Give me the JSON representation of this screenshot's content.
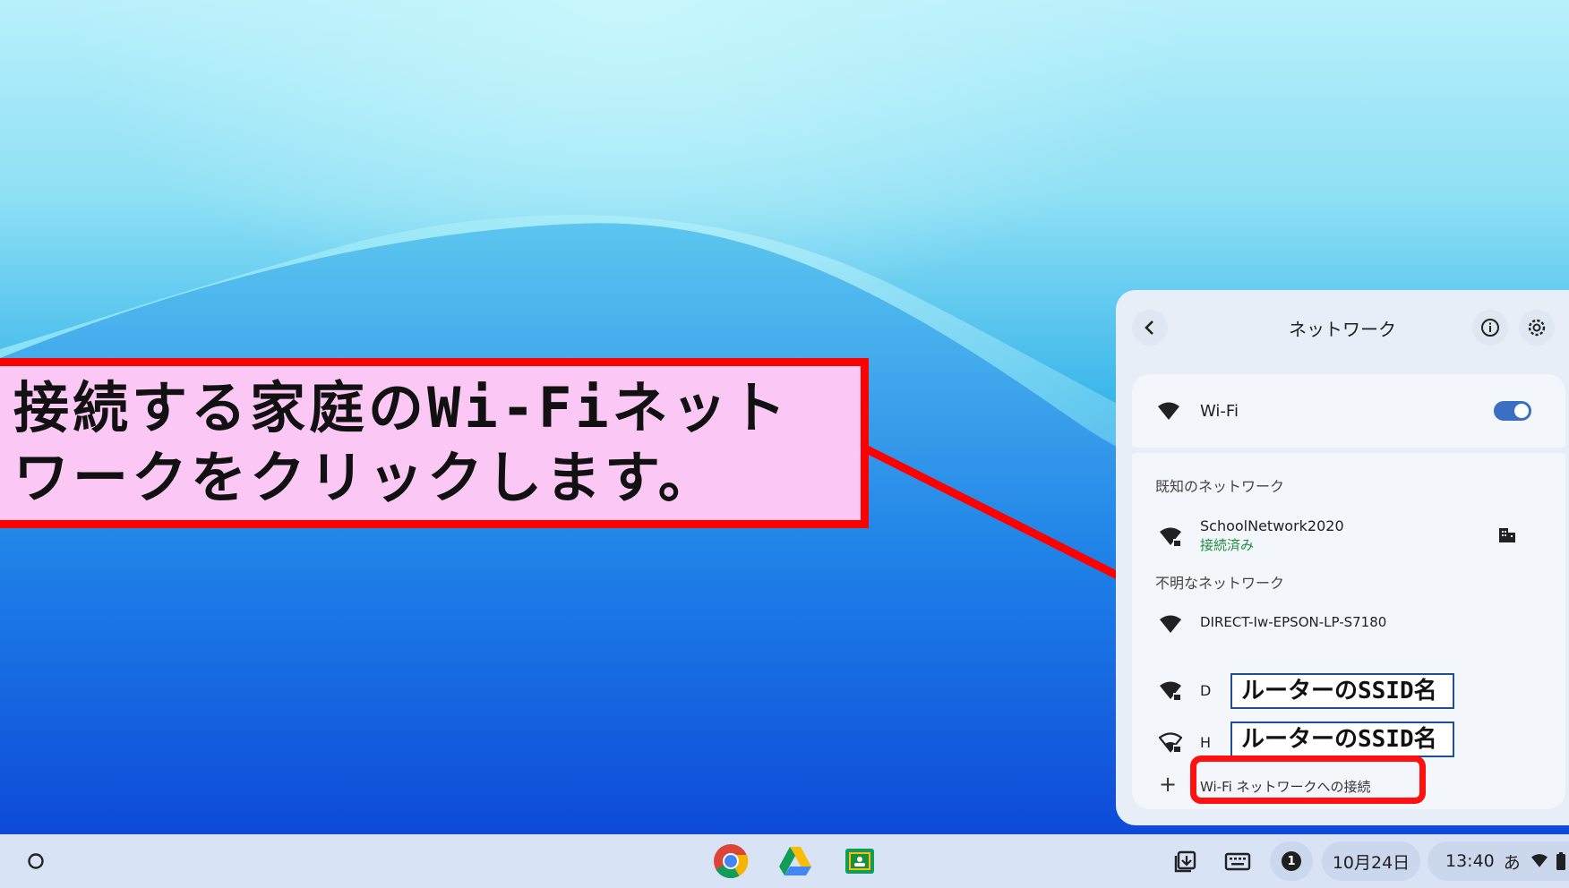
{
  "annotation": {
    "lines": [
      "接続する家庭のWi-Fiネット",
      "ワークをクリックします。"
    ]
  },
  "network_panel": {
    "title": "ネットワーク",
    "wifi_label": "Wi-Fi",
    "wifi_enabled": true,
    "known_section": "既知のネットワーク",
    "known_networks": [
      {
        "name": "SchoolNetwork2020",
        "status": "接続済み"
      }
    ],
    "unknown_section": "不明なネットワーク",
    "unknown_networks": [
      {
        "name": "DIRECT-Iw-EPSON-LP-S7180"
      },
      {
        "name": "D",
        "overlay_label": "ルーターのSSID名"
      },
      {
        "name": "H",
        "overlay_label": "ルーターのSSID名"
      }
    ],
    "add_network": "Wi-Fi ネットワークへの接続"
  },
  "shelf": {
    "date": "10月24日",
    "time": "13:40",
    "ime": "あ",
    "notification_count": "1"
  },
  "colors": {
    "annotation_border": "#ff0000",
    "annotation_fill": "#fbc7f4",
    "connected_green": "#1e8e3e",
    "toggle_on": "#3a6fc4"
  }
}
